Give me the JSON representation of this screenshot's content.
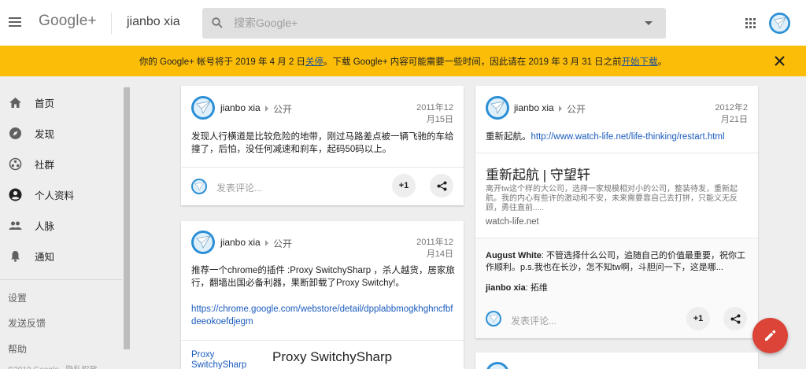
{
  "header": {
    "logo": "Google+",
    "page_title": "jianbo xia",
    "search_placeholder": "搜索Google+"
  },
  "banner": {
    "text_before": "你的 Google+ 帐号将于 2019 年 4 月 2 日",
    "link1": "关停",
    "text_middle": "。下载 Google+ 内容可能需要一些时间，因此请在 2019 年 3 月 31 日之前",
    "link2": "开始下载",
    "text_after": "。"
  },
  "sidebar": {
    "items": [
      {
        "label": "首页",
        "icon": "home-icon"
      },
      {
        "label": "发现",
        "icon": "compass-icon"
      },
      {
        "label": "社群",
        "icon": "communities-icon"
      },
      {
        "label": "个人资料",
        "icon": "profile-icon"
      },
      {
        "label": "人脉",
        "icon": "people-icon"
      },
      {
        "label": "通知",
        "icon": "bell-icon"
      }
    ],
    "links": [
      "设置",
      "发送反馈",
      "帮助"
    ],
    "footer": "©2019 Google · 隐私权政"
  },
  "posts": [
    {
      "author": "jianbo xia",
      "visibility": "公开",
      "date_line1": "2011年12",
      "date_line2": "月15日",
      "text": "发现人行横道是比较危险的地带，刚过马路差点被一辆飞驰的车给撞了，后怕，没任何减速和刹车，起码50码以上。",
      "comment_placeholder": "发表评论...",
      "plus_one": "+1"
    },
    {
      "author": "jianbo xia",
      "visibility": "公开",
      "date_line1": "2011年12",
      "date_line2": "月14日",
      "text": "推荐一个chrome的插件 :Proxy SwitchySharp ，杀人越货，居家旅行，翻墙出国必备利器，果断卸载了Proxy Switchy!。",
      "url": "https://chrome.google.com/webstore/detail/dpplabbmogkhghncfbfdeeokoefdjegm",
      "image_alt": "Proxy SwitchySharp",
      "link_title": "Proxy SwitchySharp"
    },
    {
      "author": "jianbo xia",
      "visibility": "公开",
      "date_line1": "2012年2",
      "date_line2": "月21日",
      "text_before": "重新起航。",
      "url": "http://www.watch-life.net/life-thinking/restart.html",
      "link_title": "重新起航 | 守望轩",
      "link_desc": "离开tw这个样的大公司，选择一家规模相对小的公司，整装待发，重新起航。我的内心有些许的激动和不安，未来需要靠自己去打拼，只能义无反顾，勇往直前.....",
      "link_domain": "watch-life.net",
      "comments": [
        {
          "author": "August White",
          "text": ": 不管选择什么公司，追随自己的价值最重要，祝你工作顺利。p.s.我也在长沙，怎不知tw啊，斗胆问一下，这是哪..."
        },
        {
          "author": "jianbo xia",
          "text": ": 拓维"
        }
      ],
      "comment_placeholder": "发表评论...",
      "plus_one": "+1"
    }
  ]
}
